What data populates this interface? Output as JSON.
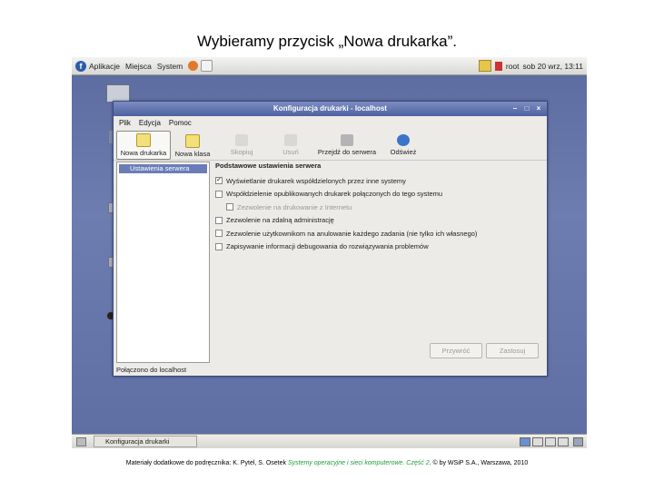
{
  "slide": {
    "title": "Wybieramy przycisk „Nowa drukarka”.",
    "footer_prefix": "Materiały dodatkowe do podręcznika: K. Pytel, S. Osetek ",
    "footer_book": "Systemy operacyjne i sieci komputerowe. Część 2",
    "footer_suffix": ". © by WSiP S.A., Warszawa, 2010"
  },
  "top_panel": {
    "menus": [
      "Aplikacje",
      "Miejsca",
      "System"
    ],
    "user": "root",
    "clock": "sob 20 wrz, 13:11"
  },
  "window": {
    "title": "Konfiguracja drukarki - localhost",
    "menu": [
      "Plik",
      "Edycja",
      "Pomoc"
    ],
    "toolbar": [
      {
        "label": "Nowa drukarka"
      },
      {
        "label": "Nowa klasa"
      },
      {
        "label": "Skopiuj"
      },
      {
        "label": "Usuń"
      },
      {
        "label": "Przejdź do serwera"
      },
      {
        "label": "Odśwież"
      }
    ],
    "left_pane_item": "Ustawienia serwera",
    "section_title": "Podstawowe ustawienia serwera",
    "options": [
      {
        "label": "Wyświetlanie drukarek współdzielonych przez inne systemy",
        "checked": "✓"
      },
      {
        "label": "Współdzielenie opublikowanych drukarek połączonych do tego systemu",
        "checked": ""
      },
      {
        "label": "Zezwolenie na drukowanie z Internetu",
        "checked": ""
      },
      {
        "label": "Zezwolenie na zdalną administrację",
        "checked": ""
      },
      {
        "label": "Zezwolenie użytkownikom na anulowanie każdego zadania (nie tylko ich własnego)",
        "checked": ""
      },
      {
        "label": "Zapisywanie informacji debugowania do rozwiązywania problemów",
        "checked": ""
      }
    ],
    "buttons": {
      "revert": "Przywróć",
      "apply": "Zastosuj"
    },
    "status": "Połączono do localhost"
  },
  "taskbar": {
    "task": "Konfiguracja drukarki"
  },
  "colors": {
    "accent": "#6b7db8",
    "desktop": "#5e6ea3",
    "titlebar": "#4e61a0"
  }
}
